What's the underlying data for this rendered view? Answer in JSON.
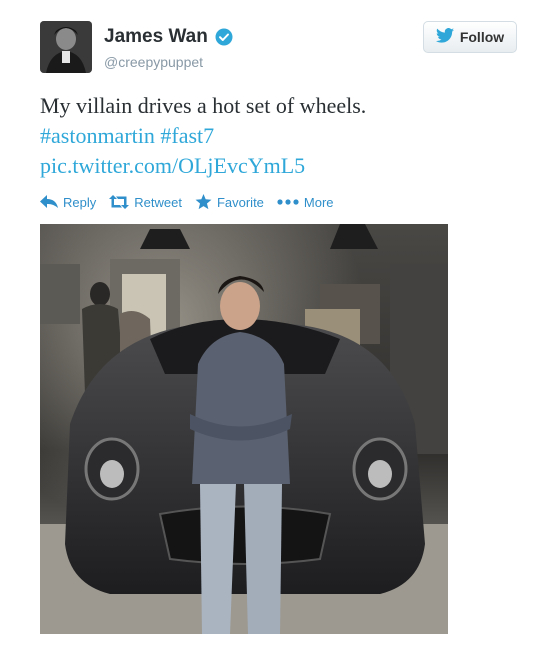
{
  "user": {
    "display_name": "James Wan",
    "handle": "@creepypuppet",
    "verified": true,
    "avatar_icon": "profile-photo"
  },
  "follow_button": {
    "label": "Follow",
    "icon": "twitter-bird-icon"
  },
  "tweet": {
    "text": "My villain drives a hot set of wheels.",
    "hashtags": [
      "#astonmartin",
      "#fast7"
    ],
    "link": "pic.twitter.com/OLjEvcYmL5"
  },
  "actions": [
    {
      "label": "Reply",
      "icon": "reply-icon"
    },
    {
      "label": "Retweet",
      "icon": "retweet-icon"
    },
    {
      "label": "Favorite",
      "icon": "star-icon"
    },
    {
      "label": "More",
      "icon": "more-icon"
    }
  ],
  "colors": {
    "link": "#2fa8d9",
    "action": "#2f8fca",
    "verified": "#2fa8d9"
  }
}
